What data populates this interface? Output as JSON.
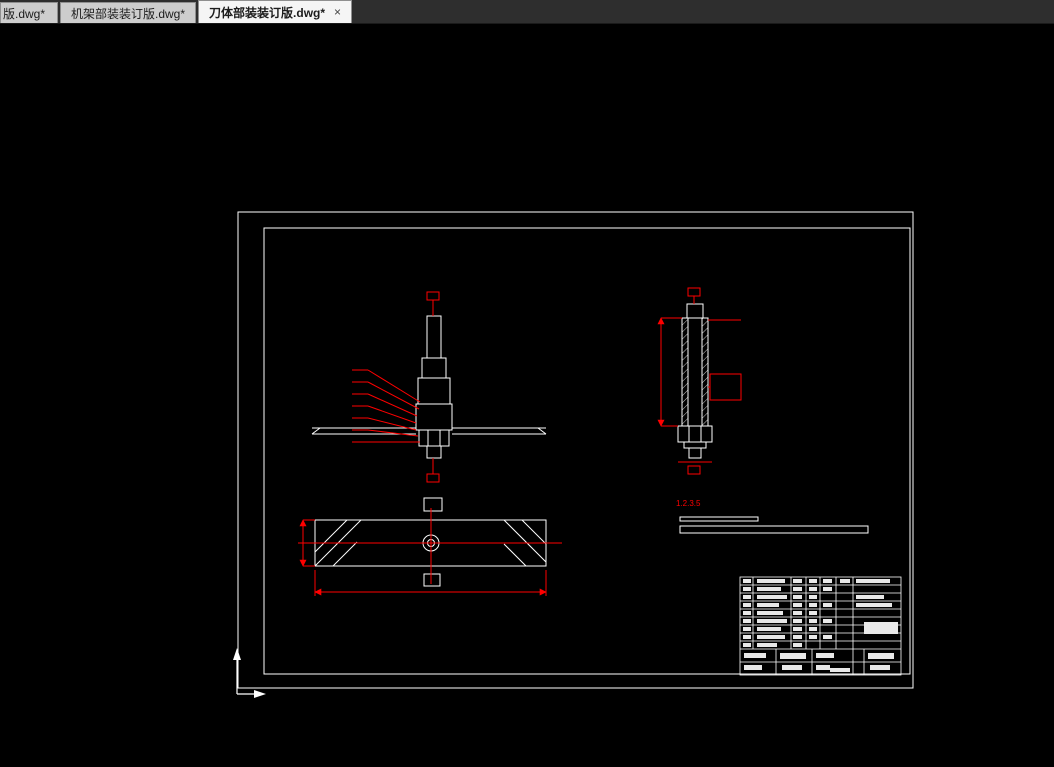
{
  "tabs": [
    {
      "label": "版.dwg*"
    },
    {
      "label": "机架部装装订版.dwg*"
    },
    {
      "label": "刀体部装装订版.dwg*",
      "close_glyph": "×"
    }
  ],
  "drawing": {
    "annotation": "1.2.3.5"
  },
  "colors": {
    "background": "#000000",
    "geometry_line": "#ffffff",
    "dimension_line": "#ff0000",
    "tab_active_bg": "#f5f5f5",
    "tab_inactive_bg": "#cdcdcd",
    "tabbar_bg": "#2e2e2e"
  }
}
